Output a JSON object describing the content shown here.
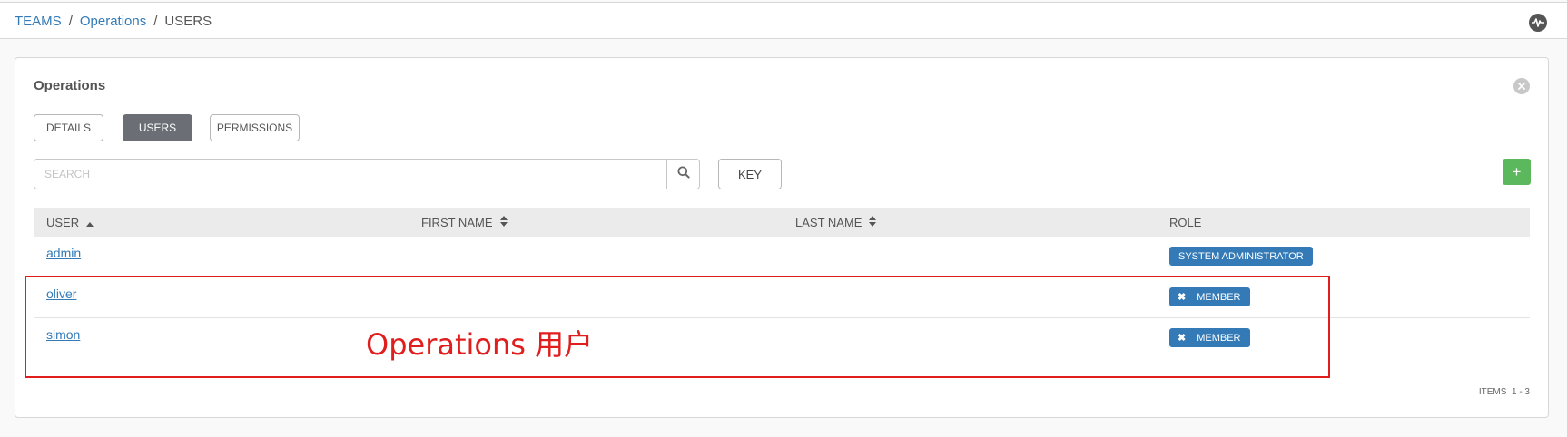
{
  "breadcrumb": {
    "items": [
      "TEAMS",
      "Operations",
      "USERS"
    ],
    "separator": "/"
  },
  "header": {
    "activity_icon": "activity-stream-icon"
  },
  "panel": {
    "title": "Operations",
    "close_icon": "close-icon"
  },
  "tabs": [
    {
      "label": "DETAILS",
      "active": false
    },
    {
      "label": "USERS",
      "active": true
    },
    {
      "label": "PERMISSIONS",
      "active": false
    }
  ],
  "search": {
    "placeholder": "SEARCH",
    "value": "",
    "icon": "search-icon"
  },
  "key_button": {
    "label": "KEY"
  },
  "add_button": {
    "label": "+"
  },
  "table": {
    "columns": [
      "USER",
      "FIRST NAME",
      "LAST NAME",
      "ROLE"
    ],
    "rows": [
      {
        "user": "admin",
        "first_name": "",
        "last_name": "",
        "role": "SYSTEM ADMINISTRATOR",
        "removable": false
      },
      {
        "user": "oliver",
        "first_name": "",
        "last_name": "",
        "role": "MEMBER",
        "removable": true
      },
      {
        "user": "simon",
        "first_name": "",
        "last_name": "",
        "role": "MEMBER",
        "removable": true
      }
    ],
    "remove_glyph": "✖"
  },
  "annotation": {
    "text": "Operations 用户",
    "color": "#e01e1e"
  },
  "pagination": {
    "label": "ITEMS",
    "range": "1 - 3"
  },
  "colors": {
    "link": "#337ab7",
    "active_tab": "#6b6f75",
    "add_button": "#5cb85c",
    "badge": "#337ab7"
  }
}
